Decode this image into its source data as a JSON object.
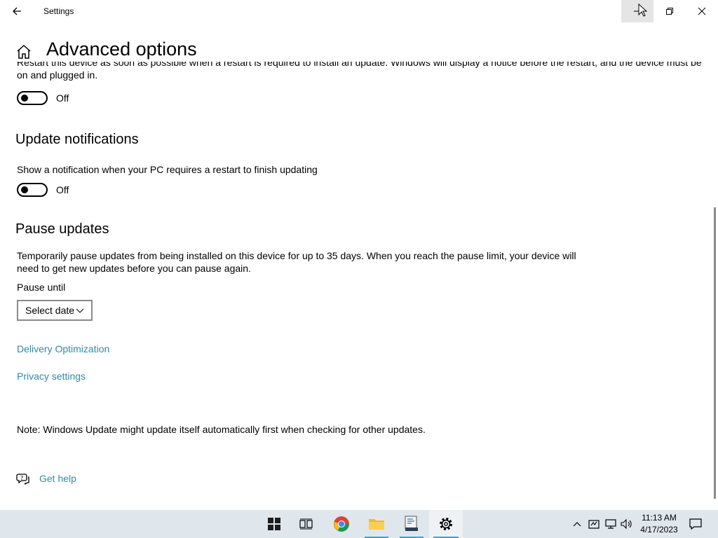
{
  "window": {
    "title": "Settings",
    "controls": [
      "minimize",
      "restore",
      "close"
    ]
  },
  "header": {
    "title": "Advanced options"
  },
  "restart_section": {
    "clipped_text_line1": "Restart this device as soon as possible when a restart is required to install an update. Windows will display a notice before the restart, and the device must be",
    "clipped_text_line2": "on and plugged in.",
    "toggle_state": "Off"
  },
  "notifications_section": {
    "heading": "Update notifications",
    "description": "Show a notification when your PC requires a restart to finish updating",
    "toggle_state": "Off"
  },
  "pause_section": {
    "heading": "Pause updates",
    "description_line1": "Temporarily pause updates from being installed on this device for up to 35 days. When you reach the pause limit, your device will",
    "description_line2": "need to get new updates before you can pause again.",
    "pause_until_label": "Pause until",
    "select_value": "Select date"
  },
  "links": {
    "delivery_optimization": "Delivery Optimization",
    "privacy_settings": "Privacy settings"
  },
  "note": "Note: Windows Update might update itself automatically first when checking for other updates.",
  "help": {
    "label": "Get help"
  },
  "taskbar": {
    "apps": [
      "start-icon",
      "task-view-icon",
      "chrome-icon",
      "file-explorer-icon",
      "app-icon",
      "settings-icon"
    ],
    "time": "11:13 AM",
    "date": "4/17/2023"
  },
  "colors": {
    "link": "#2f8aa8",
    "taskbar": "#dfe6ec",
    "accent_underline": "#3ca3d8"
  }
}
